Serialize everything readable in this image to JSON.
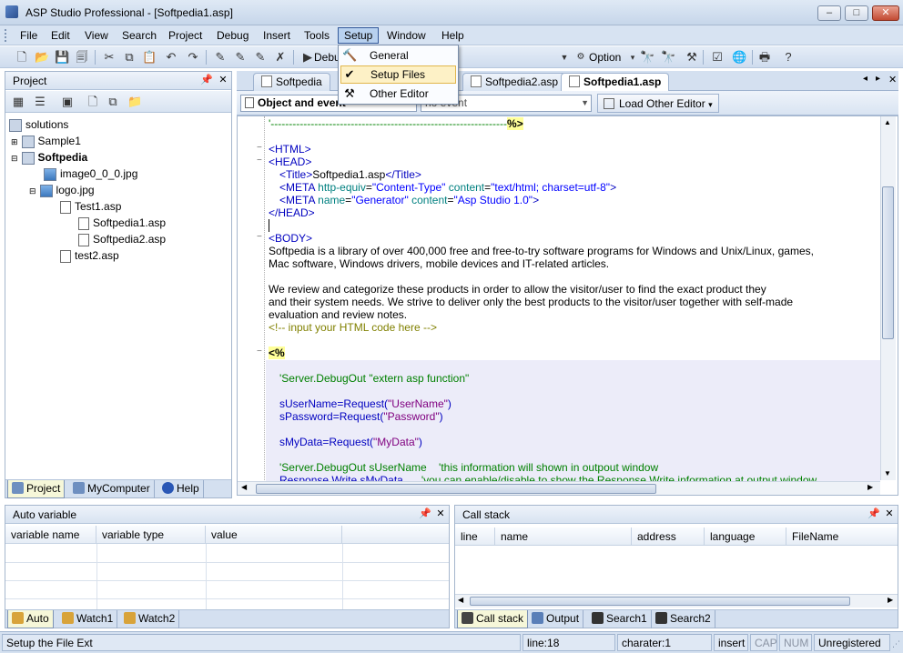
{
  "window": {
    "title": "ASP Studio Professional - [Softpedia1.asp]",
    "buttons": {
      "minimize": "–",
      "restore": "□",
      "close": "✕"
    }
  },
  "menubar": {
    "items": [
      {
        "label": "File",
        "key": "file"
      },
      {
        "label": "Edit",
        "key": "edit"
      },
      {
        "label": "View",
        "key": "view"
      },
      {
        "label": "Search",
        "key": "search"
      },
      {
        "label": "Project",
        "key": "project"
      },
      {
        "label": "Debug",
        "key": "debug"
      },
      {
        "label": "Insert",
        "key": "insert"
      },
      {
        "label": "Tools",
        "key": "tools"
      },
      {
        "label": "Setup",
        "key": "setup",
        "active": true
      },
      {
        "label": "Window",
        "key": "window"
      },
      {
        "label": "Help",
        "key": "help"
      }
    ]
  },
  "toolbar": {
    "debug_label": "Debu",
    "option_label": "Option"
  },
  "setup_menu": {
    "items": [
      {
        "label": "General",
        "icon": "hammer-icon"
      },
      {
        "label": "Setup Files",
        "icon": "checkmark-icon",
        "selected": true
      },
      {
        "label": "Other Editor",
        "icon": "tools-icon"
      }
    ]
  },
  "project_panel": {
    "title": "Project",
    "tree": [
      {
        "label": "solutions",
        "bold": false
      },
      {
        "label": "Sample1",
        "bold": false
      },
      {
        "label": "Softpedia",
        "bold": true
      },
      {
        "label": "image0_0_0.jpg",
        "bold": false
      },
      {
        "label": "logo.jpg",
        "bold": false
      },
      {
        "label": "Test1.asp",
        "bold": false
      },
      {
        "label": "Softpedia1.asp",
        "bold": false
      },
      {
        "label": "Softpedia2.asp",
        "bold": false
      },
      {
        "label": "test2.asp",
        "bold": false
      }
    ],
    "tabs": [
      "Project",
      "MyComputer",
      "Help"
    ]
  },
  "editor": {
    "tabs": [
      "Softpedia",
      "Softpedia2.asp",
      "Softpedia1.asp"
    ],
    "active_tab": "Softpedia1.asp",
    "object_combo": "Object and event",
    "event_combo": "no event",
    "load_other_editor": "Load Other Editor",
    "code": {
      "l0": "'-----------------------------------------------------------------",
      "l0_end": "%>",
      "html_open": "<HTML>",
      "head_open": "<HEAD>",
      "title_open": "<Title>",
      "title_text": "Softpedia1.asp",
      "title_close": "</Title>",
      "meta": "<META",
      "meta1_attr": "http-equiv",
      "meta1_val": "\"Content-Type\"",
      "meta1_attr2": "content",
      "meta1_val2": "\"text/html; charset=utf-8\"",
      "meta_close": ">",
      "meta2_attr": "name",
      "meta2_val": "\"Generator\"",
      "meta2_attr2": "content",
      "meta2_val2": "\"Asp Studio 1.0\"",
      "head_close": "</HEAD>",
      "body_open": "<BODY>",
      "p1a": "Softpedia is a library of over 400,000 free and free-to-try software programs for Windows and Unix/Linux, games,",
      "p1b": "Mac software, Windows drivers, mobile devices and IT-related articles.",
      "p2a": "We review and categorize these products in order to allow the visitor/user to find the exact product they",
      "p2b": "and their system needs. We strive to deliver only the best products to the visitor/user together with self-made",
      "p2c": "evaluation and review notes.",
      "comment": "<!-- input your HTML code here -->",
      "asp_open": "<%",
      "a1": "'Server.DebugOut \"extern asp function\"",
      "a2_pre": "sUserName=Request(",
      "a2_str": "\"UserName\"",
      "a3_pre": "sPassword=Request(",
      "a3_str": "\"Password\"",
      "close_paren": ")",
      "a4_pre": "sMyData=Request(",
      "a4_str": "\"MyData\"",
      "a5_code": "'Server.DebugOut sUserName",
      "a5_cmt": "'this information will shown in outpout window",
      "a6_code": "Response.Write sMyData",
      "a6_cmt": "'you can enable/disable to show the Response.Write information at output window"
    }
  },
  "auto_panel": {
    "title": "Auto variable",
    "columns": [
      "variable name",
      "variable type",
      "value"
    ],
    "tabs": [
      "Auto",
      "Watch1",
      "Watch2"
    ]
  },
  "call_panel": {
    "title": "Call stack",
    "columns": [
      "line",
      "name",
      "address",
      "language",
      "FileName"
    ],
    "tabs": [
      "Call stack",
      "Output",
      "Search1",
      "Search2"
    ]
  },
  "statusbar": {
    "message": "Setup the File Ext",
    "line": "line:18",
    "char": "charater:1",
    "mode": "insert",
    "cap": "CAP",
    "num": "NUM",
    "license": "Unregistered"
  },
  "colors": {
    "accent": "#33599a",
    "panel_bg": "#d4e0f0",
    "highlight": "#fdf1c6"
  }
}
